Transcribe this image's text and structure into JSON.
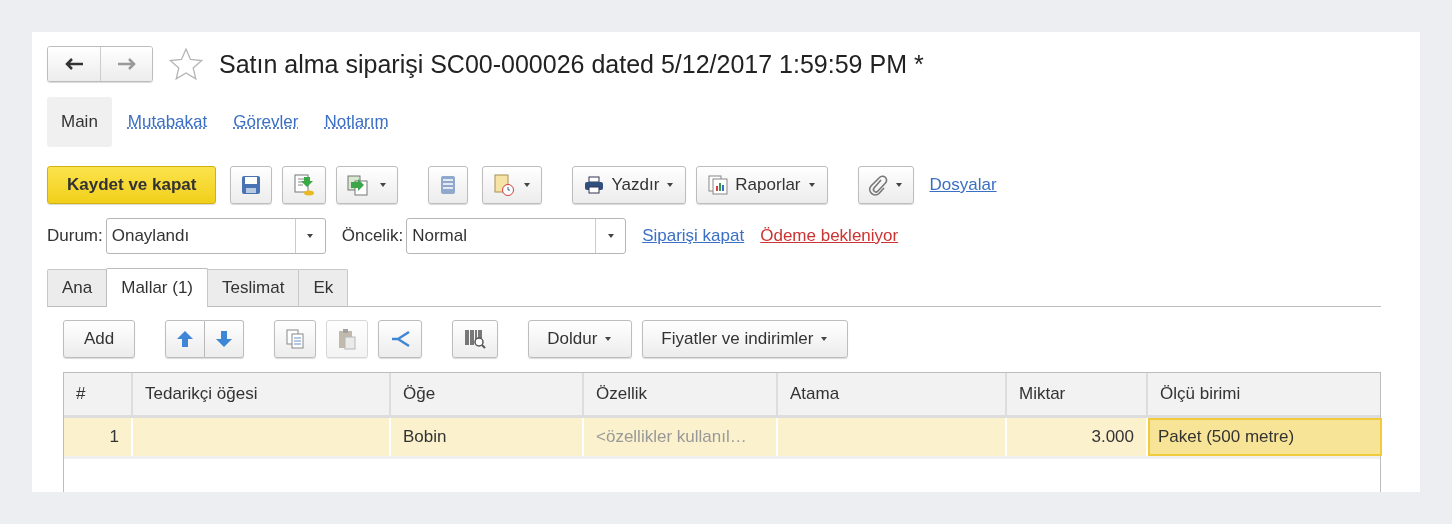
{
  "window": {
    "title": "Satın alma siparişi SC00-000026 dated 5/12/2017 1:59:59 PM *"
  },
  "nav_links": [
    {
      "label": "Main",
      "selected": true
    },
    {
      "label": "Mutabakat",
      "selected": false
    },
    {
      "label": "Görevler",
      "selected": false
    },
    {
      "label": "Notlarım",
      "selected": false
    }
  ],
  "toolbar": {
    "primary": "Kaydet ve kapat",
    "print": "Yazdır",
    "reports": "Raporlar",
    "files": "Dosyalar"
  },
  "fields": [
    {
      "label": "Durum:",
      "value": "Onaylandı"
    },
    {
      "label": "Öncelik:",
      "value": "Normal"
    }
  ],
  "links": [
    {
      "label": "Siparişi kapat",
      "kind": "action"
    },
    {
      "label": "Ödeme bekleniyor",
      "kind": "warning"
    }
  ],
  "tabs": [
    {
      "label": "Ana",
      "selected": false
    },
    {
      "label": "Mallar (1)",
      "selected": true
    },
    {
      "label": "Teslimat",
      "selected": false
    },
    {
      "label": "Ek",
      "selected": false
    }
  ],
  "grid_toolbar": {
    "add": "Add",
    "fill": "Doldur",
    "prices": "Fiyatler ve indirimler"
  },
  "table": {
    "columns": [
      {
        "label": "#",
        "numeric": true
      },
      {
        "label": "Tedarikçi öğesi"
      },
      {
        "label": "Öğe"
      },
      {
        "label": "Özellik"
      },
      {
        "label": "Atama"
      },
      {
        "label": "Miktar",
        "numeric": true
      },
      {
        "label": "Ölçü birimi"
      }
    ],
    "rows": [
      {
        "selected": true,
        "cells": [
          {
            "text": "1"
          },
          {},
          {
            "text": "Bobin"
          },
          {
            "text": "<özellikler kullanıl…",
            "placeholder": true
          },
          {},
          {
            "text": "3.000"
          },
          {
            "text": "Paket (500 metre)",
            "focused": true
          }
        ]
      }
    ]
  }
}
